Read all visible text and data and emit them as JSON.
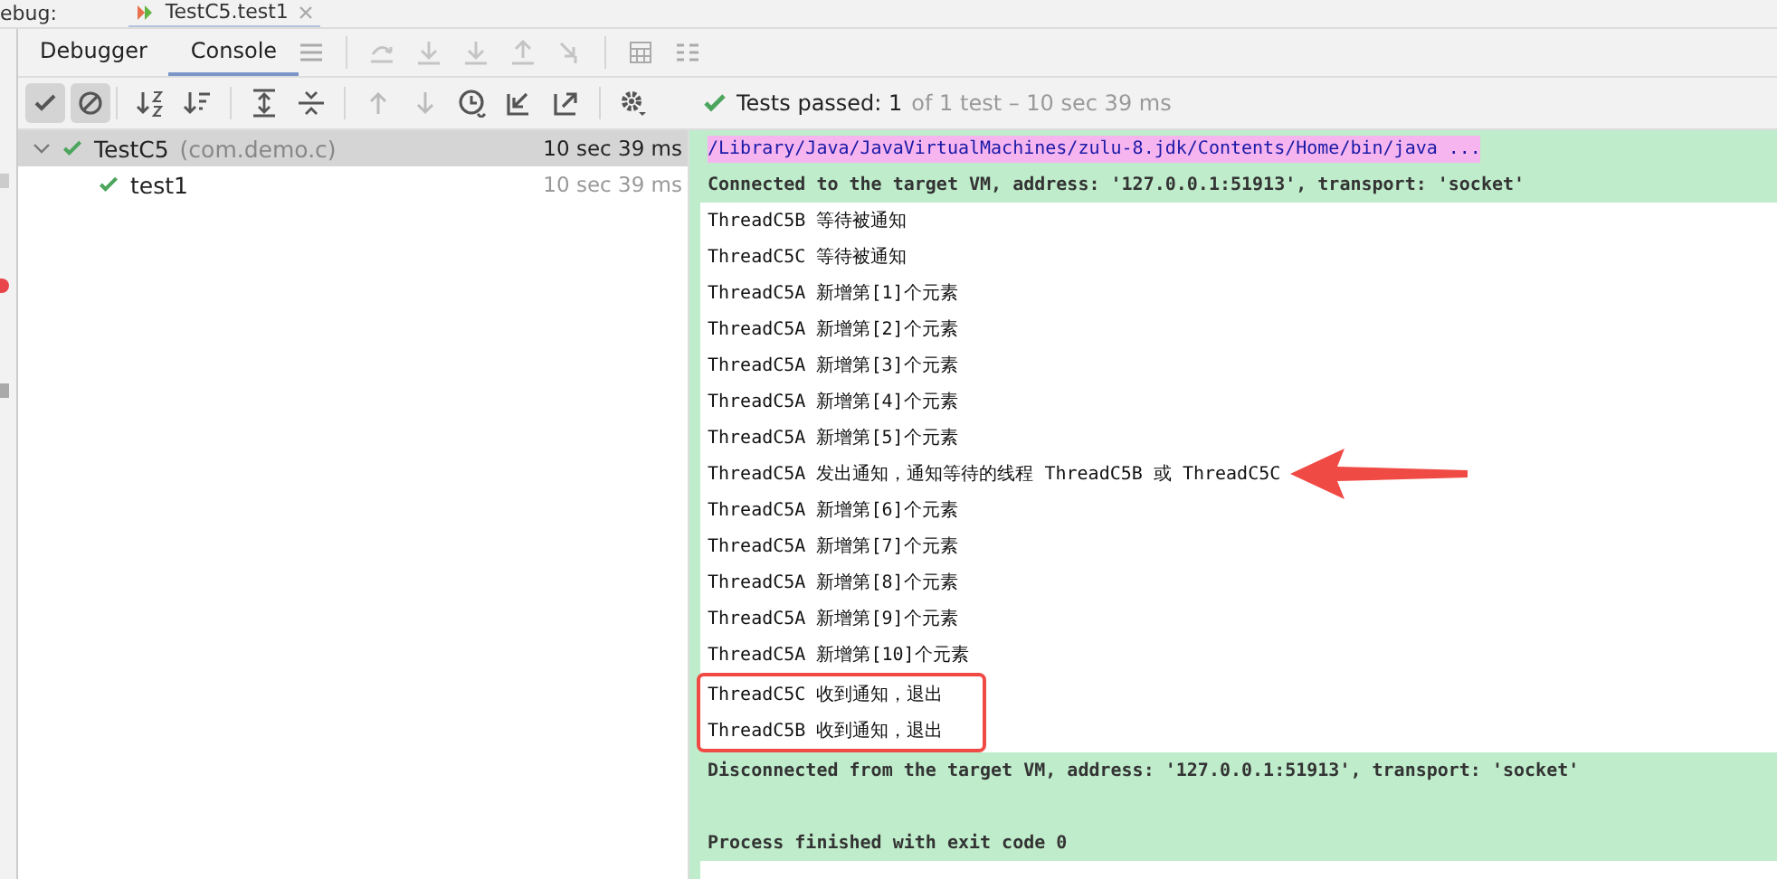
{
  "top_tab": {
    "prefix": "ebug:",
    "title": "TestC5.test1"
  },
  "tabs": [
    {
      "label": "Debugger",
      "selected": false
    },
    {
      "label": "Console",
      "selected": true
    }
  ],
  "filters": [
    {
      "kind": "passed",
      "on": true
    },
    {
      "kind": "ignored",
      "on": true
    }
  ],
  "status": {
    "label": "Tests passed: 1",
    "detail": "of 1 test – 10 sec 39 ms"
  },
  "tree": [
    {
      "name": "TestC5",
      "package": "(com.demo.c)",
      "time": "10 sec 39 ms",
      "expanded": true,
      "selected": true,
      "children": [
        {
          "name": "test1",
          "time": "10 sec 39 ms",
          "selected": false
        }
      ]
    }
  ],
  "console": [
    {
      "kind": "command",
      "text": "/Library/Java/JavaVirtualMachines/zulu-8.jdk/Contents/Home/bin/java ..."
    },
    {
      "kind": "system",
      "text": "Connected to the target VM, address: '127.0.0.1:51913', transport: 'socket'"
    },
    {
      "kind": "output",
      "text": "ThreadC5B 等待被通知"
    },
    {
      "kind": "output",
      "text": "ThreadC5C 等待被通知"
    },
    {
      "kind": "output",
      "text": "ThreadC5A 新增第[1]个元素"
    },
    {
      "kind": "output",
      "text": "ThreadC5A 新增第[2]个元素"
    },
    {
      "kind": "output",
      "text": "ThreadC5A 新增第[3]个元素"
    },
    {
      "kind": "output",
      "text": "ThreadC5A 新增第[4]个元素"
    },
    {
      "kind": "output",
      "text": "ThreadC5A 新增第[5]个元素"
    },
    {
      "kind": "output",
      "text": "ThreadC5A 发出通知，通知等待的线程 ThreadC5B 或 ThreadC5C",
      "arrow": true
    },
    {
      "kind": "output",
      "text": "ThreadC5A 新增第[6]个元素"
    },
    {
      "kind": "output",
      "text": "ThreadC5A 新增第[7]个元素"
    },
    {
      "kind": "output",
      "text": "ThreadC5A 新增第[8]个元素"
    },
    {
      "kind": "output",
      "text": "ThreadC5A 新增第[9]个元素"
    },
    {
      "kind": "output",
      "text": "ThreadC5A 新增第[10]个元素"
    },
    {
      "kind": "output",
      "text": "ThreadC5C 收到通知，退出",
      "boxed": true
    },
    {
      "kind": "output",
      "text": "ThreadC5B 收到通知，退出",
      "boxed": true
    },
    {
      "kind": "system",
      "text": "Disconnected from the target VM, address: '127.0.0.1:51913', transport: 'socket'"
    },
    {
      "kind": "blank"
    },
    {
      "kind": "system",
      "text": "Process finished with exit code 0"
    }
  ]
}
